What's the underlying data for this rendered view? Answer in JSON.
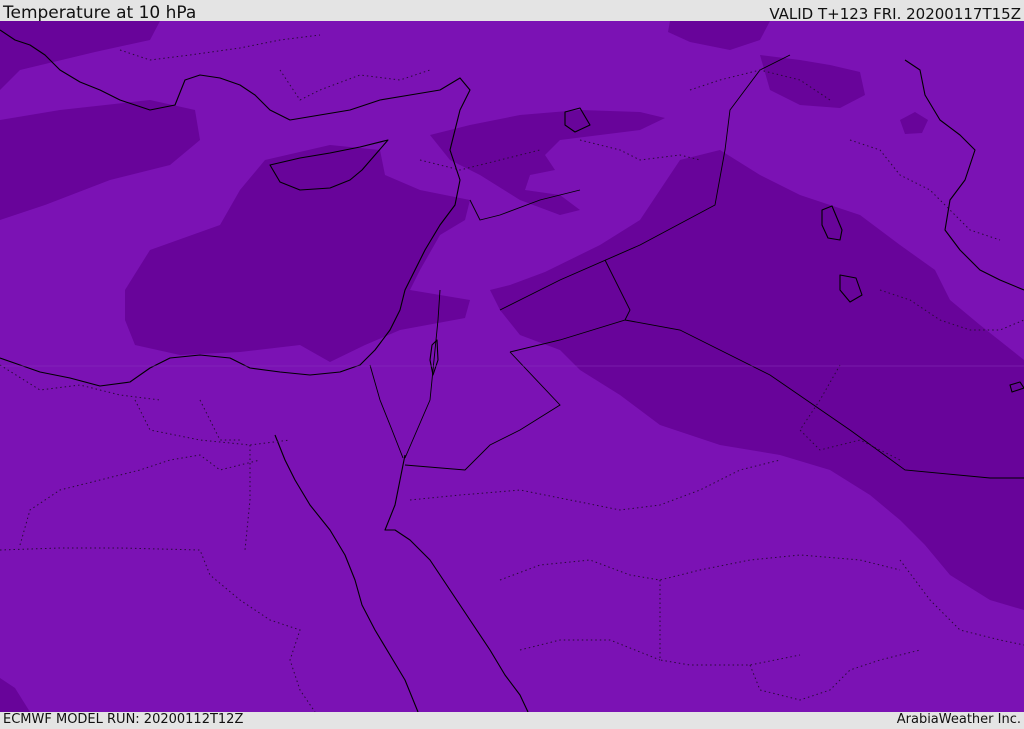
{
  "header": {
    "title": "Temperature at 10 hPa",
    "valid": "VALID T+123 FRI. 20200117T15Z"
  },
  "footer": {
    "model_run": "ECMWF MODEL RUN: 20200112T12Z",
    "credit": "ArabiaWeather Inc."
  },
  "map": {
    "colors": {
      "base": "#7b12b4",
      "cold_band": "#68049a",
      "outline": "#000000"
    }
  }
}
